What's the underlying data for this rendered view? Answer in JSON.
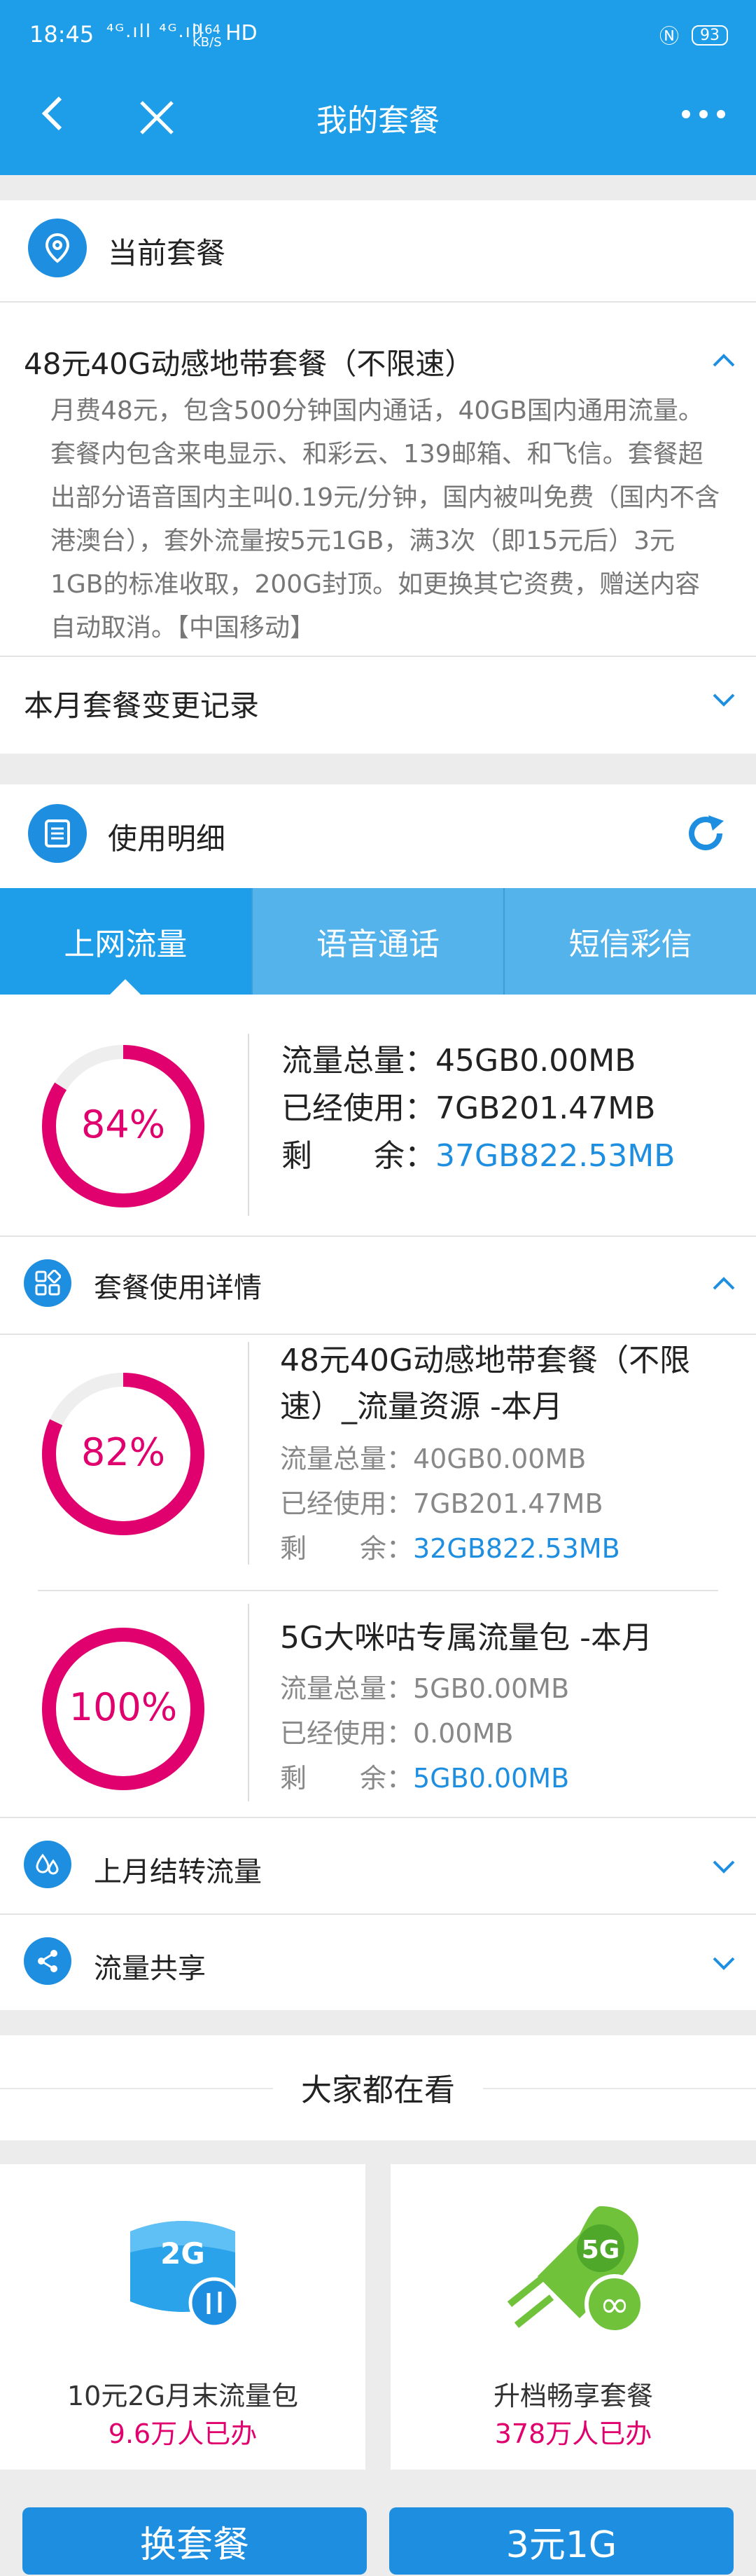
{
  "status_bar": {
    "time": "18:45",
    "signal": "⁴ᴳ.ıll ⁴ᴳ.ıll",
    "speed": "0.64 KB/S",
    "hd": "HD",
    "battery": "93"
  },
  "header": {
    "title": "我的套餐",
    "back_icon": "back-icon",
    "close_icon": "close-icon",
    "more_icon": "more-icon"
  },
  "current_plan": {
    "title": "当前套餐",
    "name": "48元40G动感地带套餐（不限速）",
    "description": "月费48元，包含500分钟国内通话，40GB国内通用流量。套餐内包含来电显示、和彩云、139邮箱、和飞信。套餐超出部分语音国内主叫0.19元/分钟，国内被叫免费（国内不含港澳台），套外流量按5元1GB，满3次（即15元后）3元1GB的标准收取，200G封顶。如更换其它资费，赠送内容自动取消。【中国移动】",
    "change_record": "本月套餐变更记录"
  },
  "usage": {
    "title": "使用明细",
    "tabs": [
      "上网流量",
      "语音通话",
      "短信彩信"
    ],
    "active_tab": 0,
    "summary": {
      "percent_label": "84%",
      "percent": 84,
      "total_label": "流量总量：",
      "total": "45GB0.00MB",
      "used_label": "已经使用：",
      "used": "7GB201.47MB",
      "remain_label": "剩　　余：",
      "remain": "37GB822.53MB"
    },
    "detail_title": "套餐使用详情",
    "details": [
      {
        "name": "48元40G动感地带套餐（不限速）_流量资源 -本月",
        "percent_label": "82%",
        "percent": 82,
        "total": "流量总量：40GB0.00MB",
        "used": "已经使用：7GB201.47MB",
        "remain_label": "剩　　余：",
        "remain": "32GB822.53MB"
      },
      {
        "name": "5G大咪咕专属流量包 -本月",
        "percent_label": "100%",
        "percent": 100,
        "total": "流量总量：5GB0.00MB",
        "used": "已经使用：0.00MB",
        "remain_label": "剩　　余：",
        "remain": "5GB0.00MB"
      }
    ],
    "carryover": "上月结转流量",
    "share": "流量共享"
  },
  "recommend": {
    "title": "大家都在看",
    "items": [
      {
        "title": "10元2G月末流量包",
        "count": "9.6万人已办",
        "badge": "2G"
      },
      {
        "title": "升档畅享套餐",
        "count": "378万人已办",
        "badge": "5G"
      }
    ]
  },
  "buttons": {
    "change_plan": "换套餐",
    "buy": "3元1G"
  },
  "colors": {
    "primary": "#1e9ee8",
    "accent": "#e0006e",
    "link": "#1e8fe0"
  }
}
